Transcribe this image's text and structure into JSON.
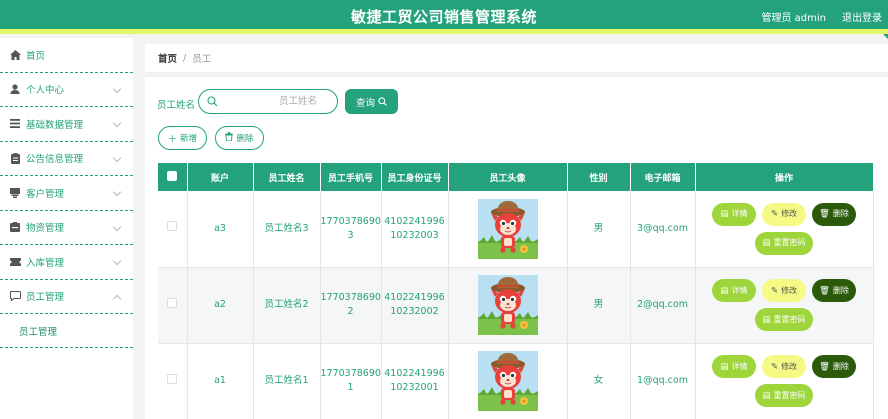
{
  "header": {
    "title": "敏捷工贸公司销售管理系统",
    "user": "管理员 admin",
    "logout": "退出登录"
  },
  "sidebar": {
    "items": [
      {
        "label": "首页",
        "icon": "home-icon"
      },
      {
        "label": "个人中心",
        "icon": "user-icon"
      },
      {
        "label": "基础数据管理",
        "icon": "list-icon"
      },
      {
        "label": "公告信息管理",
        "icon": "clipboard-icon"
      },
      {
        "label": "客户管理",
        "icon": "folder-icon"
      },
      {
        "label": "物资管理",
        "icon": "box-icon"
      },
      {
        "label": "入库管理",
        "icon": "ticket-icon"
      },
      {
        "label": "员工管理",
        "icon": "chat-icon"
      }
    ],
    "sub_items": [
      {
        "label": "员工管理"
      }
    ]
  },
  "breadcrumb": {
    "home": "首页",
    "separator": "/",
    "current": "员工"
  },
  "search": {
    "label": "员工姓名",
    "placeholder": "员工姓名",
    "button": "查询"
  },
  "actions": {
    "add": "新增",
    "delete": "删除"
  },
  "table": {
    "columns": [
      "账户",
      "员工姓名",
      "员工手机号",
      "员工身份证号",
      "员工头像",
      "性别",
      "电子邮箱",
      "操作"
    ],
    "rows": [
      {
        "account": "a3",
        "name": "员工姓名3",
        "phone_l1": "1770378690",
        "phone_l2": "3",
        "id_l1": "4102241996",
        "id_l2": "10232003",
        "gender": "男",
        "email": "3@qq.com"
      },
      {
        "account": "a2",
        "name": "员工姓名2",
        "phone_l1": "1770378690",
        "phone_l2": "2",
        "id_l1": "4102241996",
        "id_l2": "10232002",
        "gender": "男",
        "email": "2@qq.com"
      },
      {
        "account": "a1",
        "name": "员工姓名1",
        "phone_l1": "1770378690",
        "phone_l2": "1",
        "id_l1": "4102241996",
        "id_l2": "10232001",
        "gender": "女",
        "email": "1@qq.com"
      }
    ],
    "ops": {
      "detail": "详情",
      "edit": "修改",
      "delete": "删除",
      "reset": "重置密码"
    }
  },
  "colors": {
    "primary": "#23a27b",
    "accent_bar": "#e6f66a",
    "detail_btn": "#9dd53a",
    "edit_btn": "#f4fa84",
    "delete_btn": "#2a5a0a"
  }
}
